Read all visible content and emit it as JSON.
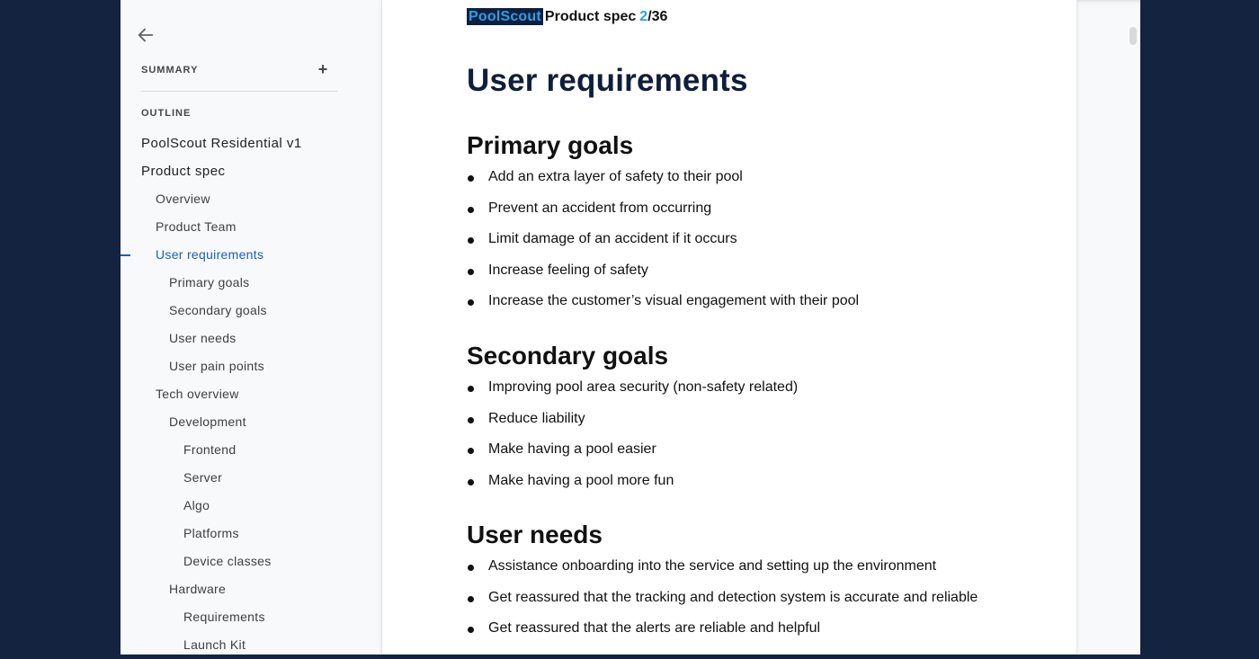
{
  "sidebar": {
    "back_icon": "arrow-left-icon",
    "summary_label": "SUMMARY",
    "add_icon": "plus-icon",
    "add_symbol": "+",
    "outline_label": "OUTLINE",
    "outline": [
      {
        "label": "PoolScout Residential v1",
        "level": 0
      },
      {
        "label": "Product spec",
        "level": 0
      },
      {
        "label": "Overview",
        "level": 1
      },
      {
        "label": "Product Team",
        "level": 1
      },
      {
        "label": "User requirements",
        "level": 1,
        "active": true
      },
      {
        "label": "Primary goals",
        "level": 2
      },
      {
        "label": "Secondary goals",
        "level": 2
      },
      {
        "label": "User needs",
        "level": 2
      },
      {
        "label": "User pain points",
        "level": 2
      },
      {
        "label": "Tech overview",
        "level": 1
      },
      {
        "label": "Development",
        "level": 2
      },
      {
        "label": "Frontend",
        "level": 3
      },
      {
        "label": "Server",
        "level": 3
      },
      {
        "label": "Algo",
        "level": 3
      },
      {
        "label": "Platforms",
        "level": 3
      },
      {
        "label": "Device classes",
        "level": 3
      },
      {
        "label": "Hardware",
        "level": 2
      },
      {
        "label": "Requirements",
        "level": 3
      },
      {
        "label": "Launch Kit",
        "level": 3
      }
    ]
  },
  "document": {
    "brand": "PoolScout",
    "doc_name": "Product spec",
    "page_current": "2",
    "page_total": "/36",
    "title": "User requirements",
    "sections": {
      "primary": {
        "heading": "Primary goals",
        "items": [
          "Add an extra layer of safety to their pool",
          "Prevent an accident from occurring",
          "Limit damage of an accident if it occurs",
          "Increase feeling of safety",
          "Increase the customer’s visual engagement with their pool"
        ]
      },
      "secondary": {
        "heading": "Secondary goals",
        "items": [
          "Improving pool area security (non-safety related)",
          "Reduce liability",
          "Make having a pool easier",
          "Make having a pool more fun"
        ]
      },
      "needs": {
        "heading": "User needs",
        "items": [
          "Assistance onboarding into the service and setting up the environment",
          "Get reassured that the tracking and detection system is accurate and reliable",
          "Get reassured that the alerts are reliable and helpful"
        ]
      }
    }
  },
  "colors": {
    "background": "#14233f",
    "panel": "#f8f9fa",
    "active_link": "#1a5fb4",
    "brand_bg": "#0d1f3d",
    "brand_text": "#2aa0e8"
  }
}
